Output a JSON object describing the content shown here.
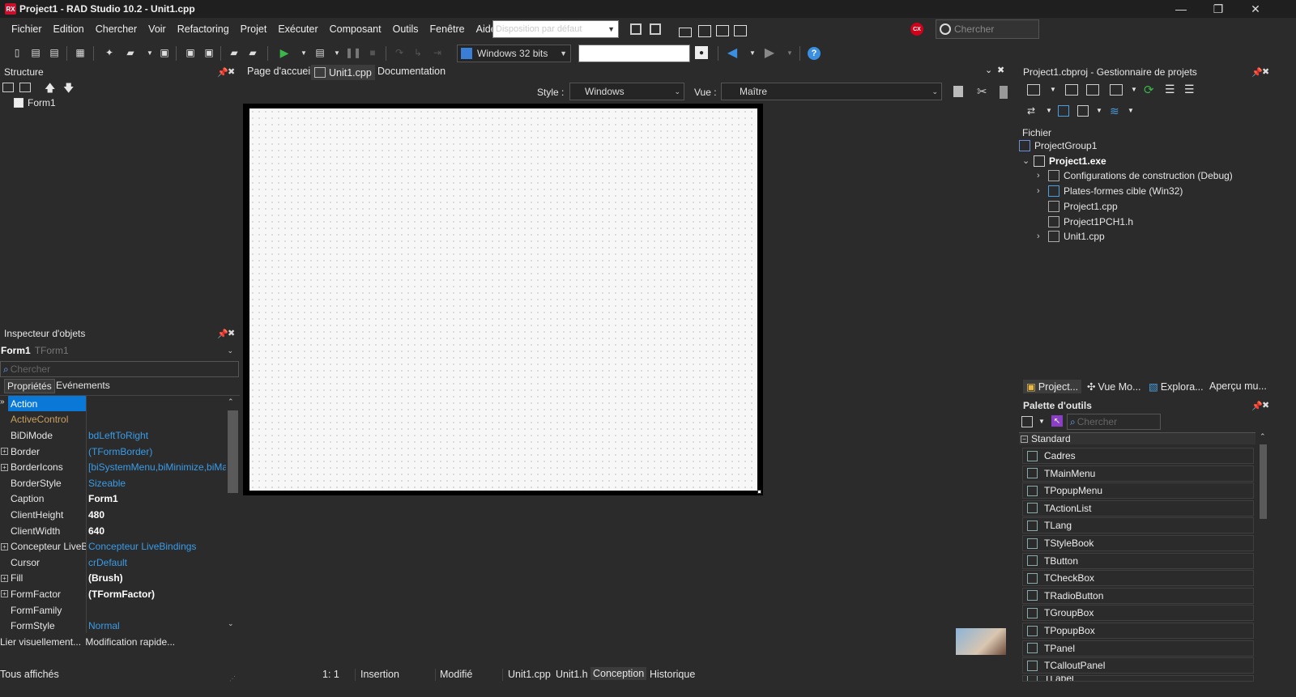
{
  "window": {
    "title": "Project1 - RAD Studio 10.2 - Unit1.cpp",
    "logo": "RX",
    "minimize": "—",
    "restore": "❐",
    "close": "✕"
  },
  "menu": [
    "Fichier",
    "Edition",
    "Chercher",
    "Voir",
    "Refactoring",
    "Projet",
    "Exécuter",
    "Composant",
    "Outils",
    "Fenêtre",
    "Aide"
  ],
  "layout_combo": {
    "placeholder": "Disposition par défaut"
  },
  "search_top": {
    "placeholder": "Chercher"
  },
  "toolbar": {
    "platform": "Windows 32 bits",
    "config_value": ""
  },
  "structure": {
    "title": "Structure",
    "items": [
      "Form1"
    ]
  },
  "doc_tabs": [
    {
      "label": "Page d'accueil"
    },
    {
      "label": "Unit1.cpp"
    },
    {
      "label": "Documentation"
    }
  ],
  "designer": {
    "style_label": "Style :",
    "style_value": "Windows",
    "view_label": "Vue :",
    "view_value": "Maître"
  },
  "inspector": {
    "title": "Inspecteur d'objets",
    "object_name": "Form1",
    "object_type": "TForm1",
    "search_placeholder": "Chercher",
    "tabs": [
      "Propriétés",
      "Evénements"
    ],
    "rows": [
      {
        "name": "Action",
        "value": "",
        "style": "sel",
        "expand": false
      },
      {
        "name": "ActiveControl",
        "value": "",
        "style": "dim",
        "expand": false
      },
      {
        "name": "BiDiMode",
        "value": "bdLeftToRight",
        "style": "blue",
        "expand": false
      },
      {
        "name": "Border",
        "value": "(TFormBorder)",
        "style": "blue",
        "expand": true
      },
      {
        "name": "BorderIcons",
        "value": "[biSystemMenu,biMinimize,biMa",
        "style": "blue",
        "expand": true
      },
      {
        "name": "BorderStyle",
        "value": "Sizeable",
        "style": "blue",
        "expand": false
      },
      {
        "name": "Caption",
        "value": "Form1",
        "style": "bold",
        "expand": false
      },
      {
        "name": "ClientHeight",
        "value": "480",
        "style": "bold",
        "expand": false
      },
      {
        "name": "ClientWidth",
        "value": "640",
        "style": "bold",
        "expand": false
      },
      {
        "name": "Concepteur LiveBi",
        "value": "Concepteur LiveBindings",
        "style": "blue",
        "expand": true
      },
      {
        "name": "Cursor",
        "value": "crDefault",
        "style": "blue",
        "expand": false
      },
      {
        "name": "Fill",
        "value": "(Brush)",
        "style": "bold",
        "expand": true
      },
      {
        "name": "FormFactor",
        "value": "(TFormFactor)",
        "style": "bold",
        "expand": true
      },
      {
        "name": "FormFamily",
        "value": "",
        "style": "normal",
        "expand": false
      },
      {
        "name": "FormStyle",
        "value": "Normal",
        "style": "blue",
        "expand": false
      }
    ],
    "footer_link1": "Lier visuellement...",
    "footer_link2": "Modification rapide...",
    "status": "Tous affichés"
  },
  "project_manager": {
    "title": "Project1.cbproj - Gestionnaire de projets",
    "section": "Fichier",
    "tree": [
      {
        "label": "ProjectGroup1",
        "level": 0,
        "expander": "",
        "bold": false
      },
      {
        "label": "Project1.exe",
        "level": 1,
        "expander": "⌄",
        "bold": true
      },
      {
        "label": "Configurations de construction (Debug)",
        "level": 2,
        "expander": "›",
        "bold": false
      },
      {
        "label": "Plates-formes cible (Win32)",
        "level": 2,
        "expander": "›",
        "bold": false
      },
      {
        "label": "Project1.cpp",
        "level": 2,
        "expander": "",
        "bold": false
      },
      {
        "label": "Project1PCH1.h",
        "level": 2,
        "expander": "",
        "bold": false
      },
      {
        "label": "Unit1.cpp",
        "level": 2,
        "expander": "›",
        "bold": false
      }
    ],
    "bottom_tabs": [
      "Project...",
      "Vue Mo...",
      "Explora...",
      "Aperçu mu..."
    ]
  },
  "palette": {
    "title": "Palette d'outils",
    "search_placeholder": "Chercher",
    "category": "Standard",
    "items": [
      "Cadres",
      "TMainMenu",
      "TPopupMenu",
      "TActionList",
      "TLang",
      "TStyleBook",
      "TButton",
      "TCheckBox",
      "TRadioButton",
      "TGroupBox",
      "TPopupBox",
      "TPanel",
      "TCalloutPanel",
      "TLabel"
    ]
  },
  "statusbar": {
    "position": "1:  1",
    "mode": "Insertion",
    "state": "Modifié",
    "tabs": [
      "Unit1.cpp",
      "Unit1.h",
      "Conception",
      "Historique"
    ]
  }
}
